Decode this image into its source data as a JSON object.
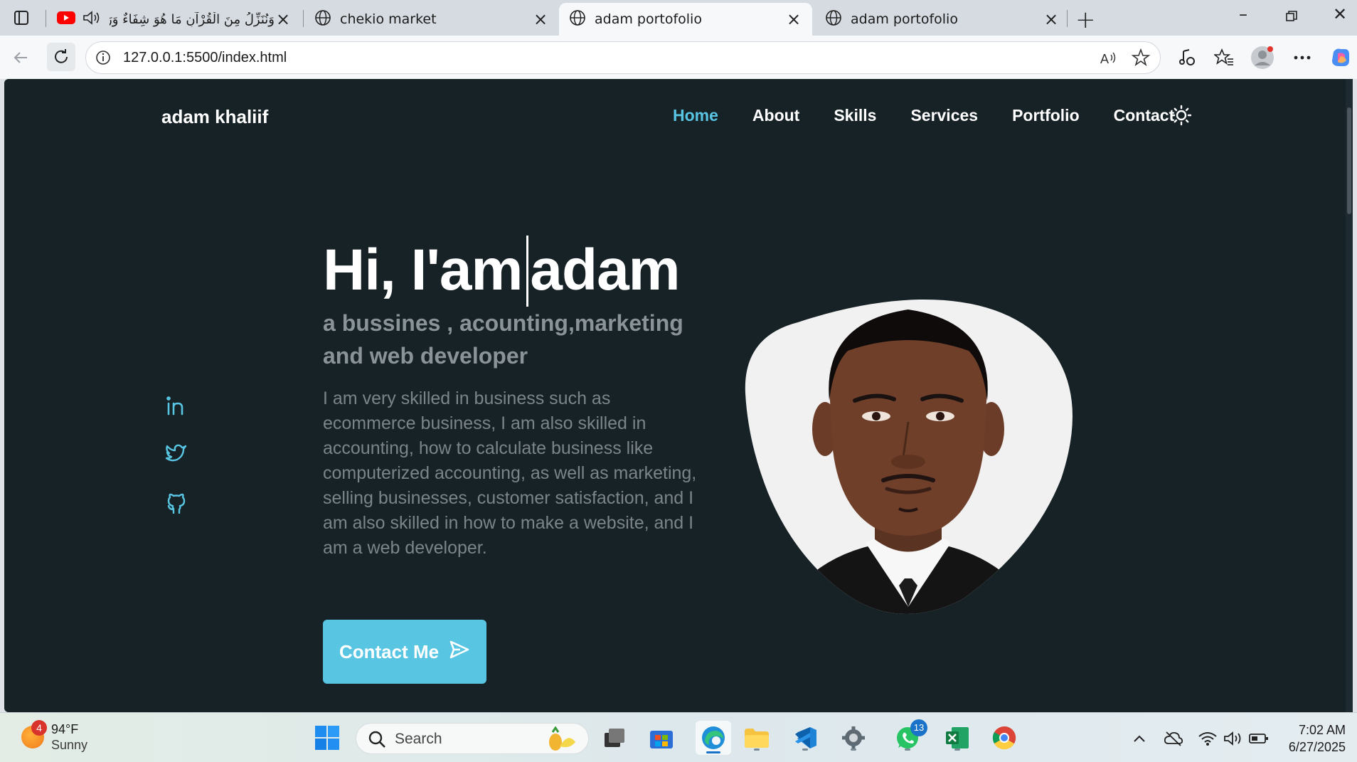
{
  "browser": {
    "tabs": [
      {
        "title": "وَنُنَزِّلُ مِنَ الْقُرْآنِ مَا هُوَ شِفَاءٌ وَرَ",
        "icon": "youtube-icon",
        "audio": true,
        "active": false
      },
      {
        "title": "chekio market",
        "icon": "globe-icon",
        "active": false
      },
      {
        "title": "adam portofolio",
        "icon": "globe-icon",
        "active": true
      },
      {
        "title": "adam portofolio",
        "icon": "globe-icon",
        "active": false
      }
    ],
    "address": "127.0.0.1:5500/index.html"
  },
  "page": {
    "brand": "adam khaliif",
    "nav": [
      {
        "label": "Home",
        "active": true
      },
      {
        "label": "About",
        "active": false
      },
      {
        "label": "Skills",
        "active": false
      },
      {
        "label": "Services",
        "active": false
      },
      {
        "label": "Portfolio",
        "active": false
      },
      {
        "label": "Contact",
        "active": false
      }
    ],
    "hero": {
      "greeting": "Hi, I'am",
      "name": "adam",
      "subtitle": "a bussines , acounting,marketing and web developer",
      "description": "I am very skilled in business such as ecommerce business, I am also skilled in accounting, how to calculate business like computerized accounting, as well as marketing, selling businesses, customer satisfaction, and I am also skilled in how to make a website, and I am a web developer.",
      "button": "Contact Me"
    },
    "social": [
      "linkedin-icon",
      "twitter-icon",
      "github-icon"
    ],
    "colors": {
      "accent": "#58c6e3",
      "background": "#172227"
    }
  },
  "taskbar": {
    "weather": {
      "temp": "94°F",
      "condition": "Sunny",
      "badge": "4"
    },
    "search_placeholder": "Search",
    "whatsapp_badge": "13",
    "time": "7:02 AM",
    "date": "6/27/2025"
  }
}
